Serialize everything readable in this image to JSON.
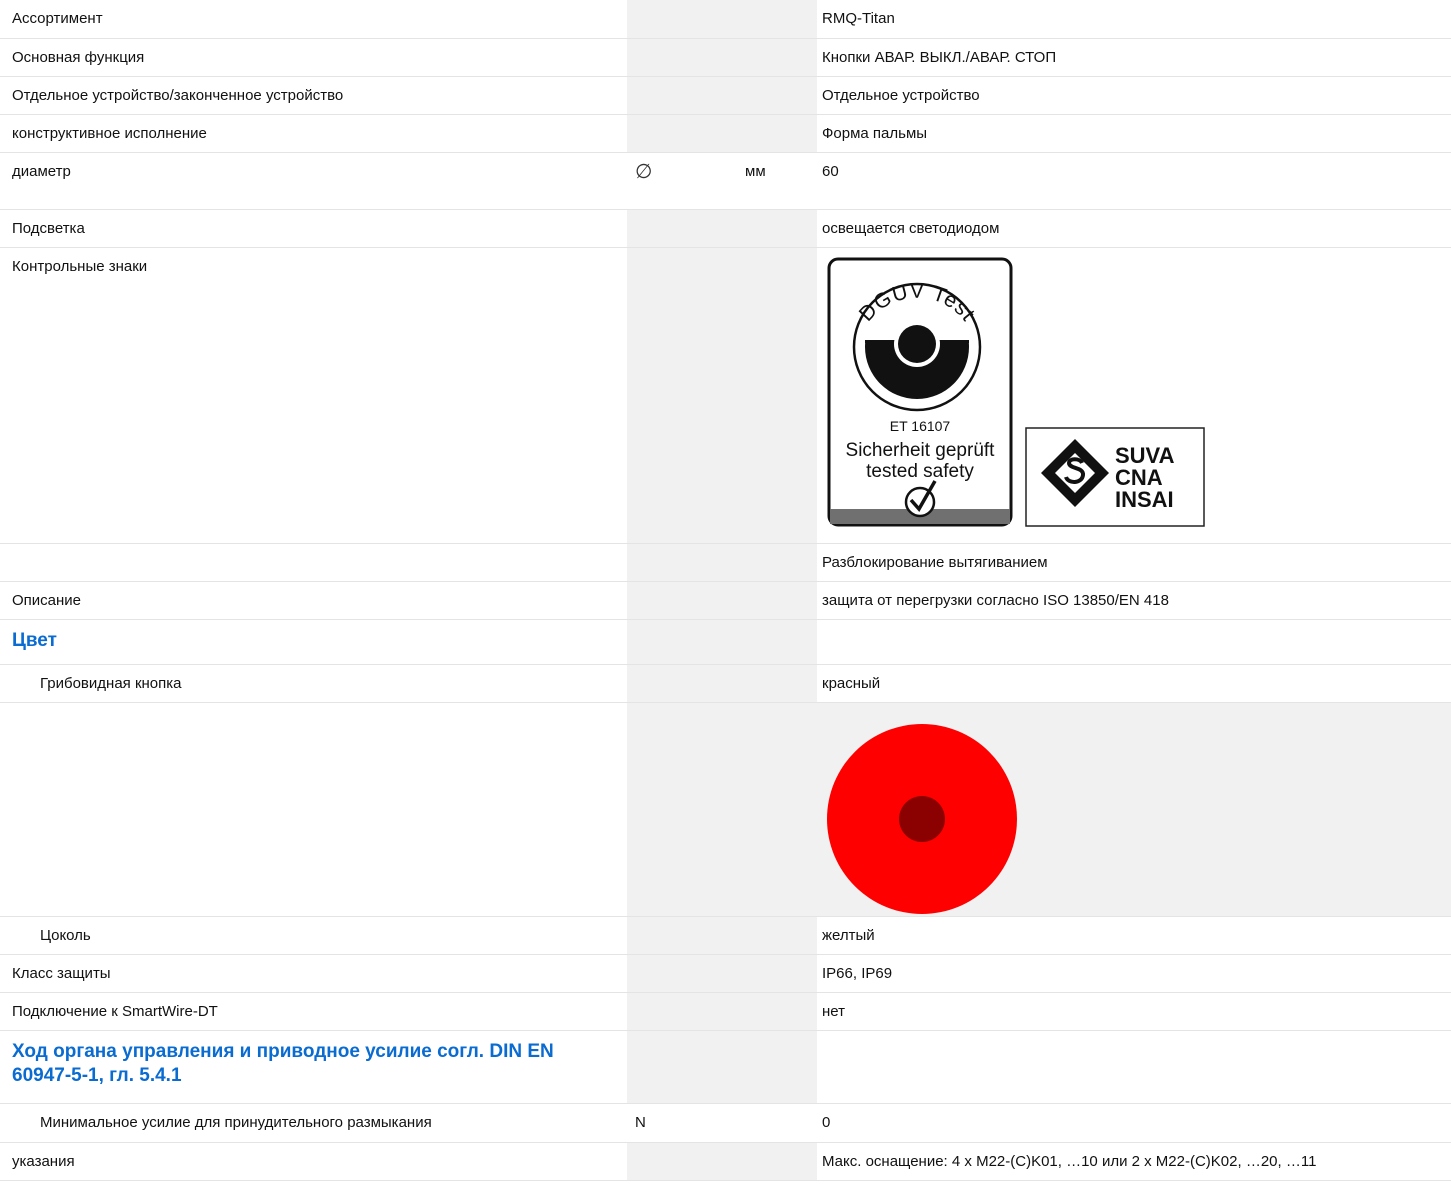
{
  "rows": {
    "assortment": {
      "label": "Ассортимент",
      "value": "RMQ-Titan"
    },
    "main_function": {
      "label": "Основная функция",
      "value": "Кнопки АВАР. ВЫКЛ./АВАР. СТОП"
    },
    "device_type": {
      "label": "Отдельное устройство/законченное устройство",
      "value": "Отдельное устройство"
    },
    "design": {
      "label": "конструктивное исполнение",
      "value": "Форма пальмы"
    },
    "diameter": {
      "label": "диаметр",
      "symbol": "∅",
      "unit": "мм",
      "value": "60"
    },
    "lighting": {
      "label": "Подсветка",
      "value": "освещается светодиодом"
    },
    "marks": {
      "label": "Контрольные знаки"
    },
    "unlock": {
      "label": "",
      "value": "Разблокирование вытягиванием"
    },
    "description": {
      "label": "Описание",
      "value": "защита от перегрузки согласно ISO 13850/EN 418"
    },
    "mushroom": {
      "label": "Грибовидная кнопка",
      "value": "красный"
    },
    "base": {
      "label": "Цоколь",
      "value": "желтый"
    },
    "protection": {
      "label": "Класс защиты",
      "value": "IP66, IP69"
    },
    "smartwire": {
      "label": "Подключение к SmartWire-DT",
      "value": "нет"
    },
    "min_force": {
      "label": "Минимальное усилие для принудительного размыкания",
      "symbol": "N",
      "value": "0"
    },
    "notes": {
      "label": "указания",
      "value": "Макс. оснащение: 4 x M22-(C)K01, …10 или 2 x M22-(C)K02, …20, …11"
    }
  },
  "sections": {
    "color": "Цвет",
    "travel": "Ход органа управления и приводное усилие согл. DIN EN 60947-5-1, гл. 5.4.1"
  },
  "dguv_logo": {
    "arc_text": "DGUV Test",
    "number": "ET 16107",
    "line1": "Sicherheit geprüft",
    "line2": "tested safety"
  },
  "suva_logo": {
    "line1": "SUVA",
    "line2": "CNA",
    "line3": "INSAI"
  },
  "colors": {
    "accent": "#0a6bd1",
    "button_red": "#ff0000",
    "button_center": "#8b0000"
  }
}
